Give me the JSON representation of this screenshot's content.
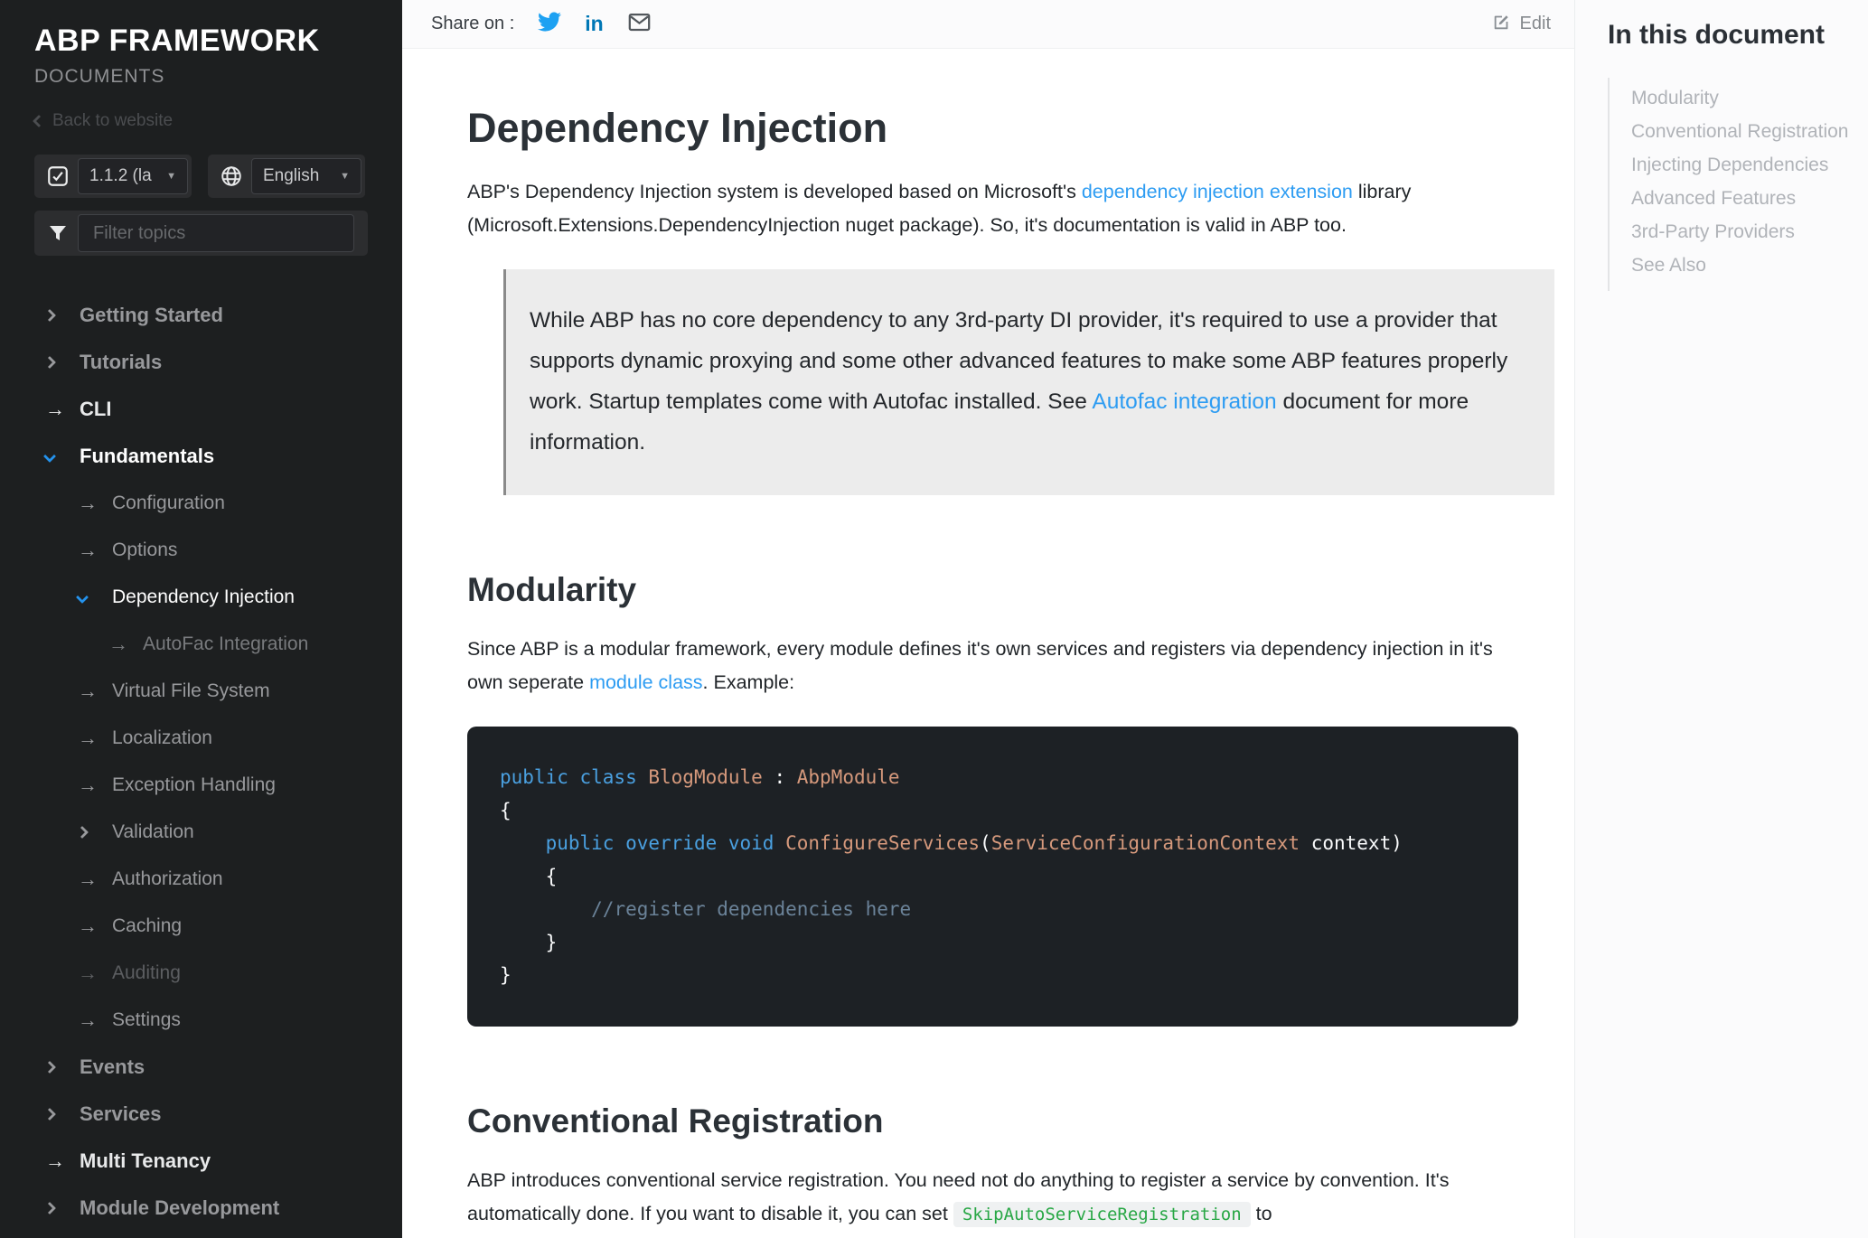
{
  "colors": {
    "accent_link": "#2d9cf2",
    "nav_expanded_chevron": "#2492ec",
    "twitter": "#1da1f2",
    "linkedin": "#0077b5",
    "code_keyword": "#4aa0e0",
    "code_type": "#d6997c",
    "code_comment": "#6b8399",
    "inline_code_green": "#28a745"
  },
  "sidebar": {
    "title": "ABP FRAMEWORK",
    "subtitle": "DOCUMENTS",
    "back_link": "Back to website",
    "version_value": "1.1.2 (la",
    "language_value": "English",
    "filter_placeholder": "Filter topics",
    "nav": [
      {
        "label": "Getting Started",
        "level": 0,
        "marker": "chevron-right",
        "tone": "default"
      },
      {
        "label": "Tutorials",
        "level": 0,
        "marker": "chevron-right",
        "tone": "default"
      },
      {
        "label": "CLI",
        "level": 0,
        "marker": "arrow",
        "tone": "bright"
      },
      {
        "label": "Fundamentals",
        "level": 0,
        "marker": "chevron-down",
        "tone": "active"
      },
      {
        "label": "Configuration",
        "level": 1,
        "marker": "arrow",
        "tone": "default"
      },
      {
        "label": "Options",
        "level": 1,
        "marker": "arrow",
        "tone": "default"
      },
      {
        "label": "Dependency Injection",
        "level": 1,
        "marker": "chevron-down",
        "tone": "active"
      },
      {
        "label": "AutoFac Integration",
        "level": 2,
        "marker": "arrow",
        "tone": "muted"
      },
      {
        "label": "Virtual File System",
        "level": 1,
        "marker": "arrow",
        "tone": "default"
      },
      {
        "label": "Localization",
        "level": 1,
        "marker": "arrow",
        "tone": "default"
      },
      {
        "label": "Exception Handling",
        "level": 1,
        "marker": "arrow",
        "tone": "default"
      },
      {
        "label": "Validation",
        "level": 1,
        "marker": "chevron-right",
        "tone": "default"
      },
      {
        "label": "Authorization",
        "level": 1,
        "marker": "arrow",
        "tone": "default"
      },
      {
        "label": "Caching",
        "level": 1,
        "marker": "arrow",
        "tone": "default"
      },
      {
        "label": "Auditing",
        "level": 1,
        "marker": "arrow",
        "tone": "dim"
      },
      {
        "label": "Settings",
        "level": 1,
        "marker": "arrow",
        "tone": "default"
      },
      {
        "label": "Events",
        "level": 0,
        "marker": "chevron-right",
        "tone": "default"
      },
      {
        "label": "Services",
        "level": 0,
        "marker": "chevron-right",
        "tone": "default"
      },
      {
        "label": "Multi Tenancy",
        "level": 0,
        "marker": "arrow",
        "tone": "bright"
      },
      {
        "label": "Module Development",
        "level": 0,
        "marker": "chevron-right",
        "tone": "default"
      }
    ]
  },
  "topbar": {
    "share_label": "Share on :",
    "edit_label": "Edit"
  },
  "toc": {
    "title": "In this document",
    "items": [
      "Modularity",
      "Conventional Registration",
      "Injecting Dependencies",
      "Advanced Features",
      "3rd-Party Providers",
      "See Also"
    ]
  },
  "article": {
    "title": "Dependency Injection",
    "intro": [
      {
        "text": "ABP's Dependency Injection system is developed based on Microsoft's "
      },
      {
        "text": "dependency injection extension",
        "link": true
      },
      {
        "text": " library (Microsoft.Extensions.DependencyInjection nuget package). So, it's documentation is valid in ABP too."
      }
    ],
    "note": [
      {
        "text": "While ABP has no core dependency to any 3rd-party DI provider, it's required to use a provider that supports dynamic proxying and some other advanced features to make some ABP features properly work. Startup templates come with Autofac installed. See "
      },
      {
        "text": "Autofac integration",
        "link": true
      },
      {
        "text": " document for more information."
      }
    ],
    "sections": {
      "modularity": {
        "heading": "Modularity",
        "body": [
          {
            "text": "Since ABP is a modular framework, every module defines it's own services and registers via dependency injection in it's own seperate "
          },
          {
            "text": "module class",
            "link": true
          },
          {
            "text": ". Example:"
          }
        ]
      },
      "conventional": {
        "heading": "Conventional Registration",
        "body": [
          {
            "text": "ABP introduces conventional service registration. You need not do anything to register a service by convention. It's automatically done. If you want to disable it, you can set "
          },
          {
            "text": "SkipAutoServiceRegistration",
            "code": true
          },
          {
            "text": " to"
          }
        ]
      }
    },
    "code": {
      "lines": [
        [
          {
            "t": "public class ",
            "c": "kw"
          },
          {
            "t": "BlogModule",
            "c": "type"
          },
          {
            "t": " : "
          },
          {
            "t": "AbpModule",
            "c": "type"
          }
        ],
        [
          {
            "t": "{"
          }
        ],
        [
          {
            "t": "    "
          },
          {
            "t": "public override void ",
            "c": "kw"
          },
          {
            "t": "ConfigureServices",
            "c": "type"
          },
          {
            "t": "("
          },
          {
            "t": "ServiceConfigurationContext",
            "c": "type"
          },
          {
            "t": " context)"
          }
        ],
        [
          {
            "t": "    {"
          }
        ],
        [
          {
            "t": "        "
          },
          {
            "t": "//register dependencies here",
            "c": "cm"
          }
        ],
        [
          {
            "t": "    }"
          }
        ],
        [
          {
            "t": "}"
          }
        ]
      ]
    }
  }
}
